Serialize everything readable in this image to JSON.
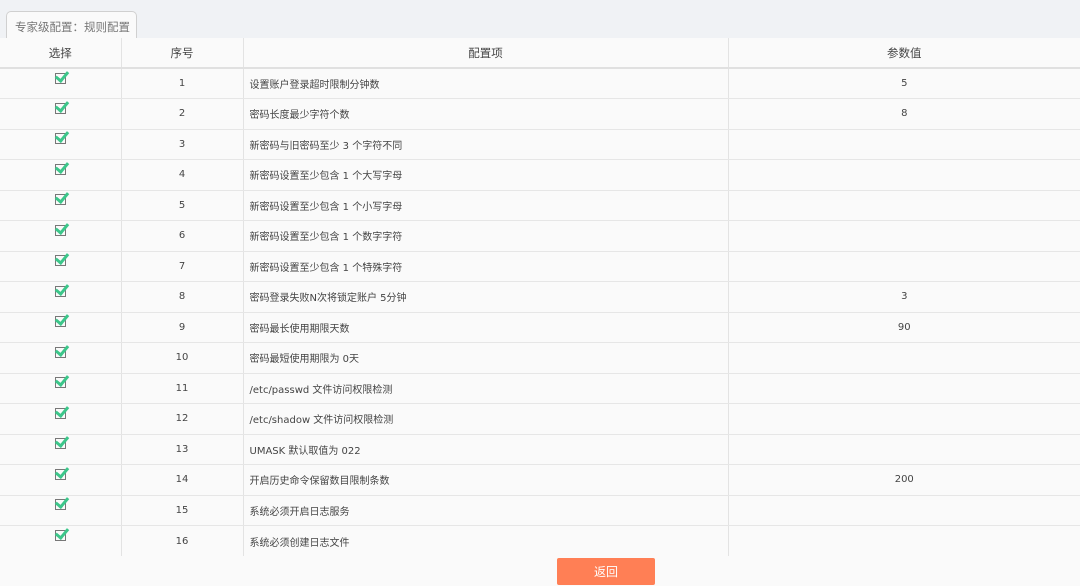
{
  "tab": "专家级配置：规则配置",
  "columns": [
    "选择",
    "序号",
    "配置项",
    "参数值"
  ],
  "rows": [
    {
      "no": "1",
      "item": "设置账户登录超时限制分钟数",
      "value": "5"
    },
    {
      "no": "2",
      "item": "密码长度最少字符个数",
      "value": "8"
    },
    {
      "no": "3",
      "item": "新密码与旧密码至少 3 个字符不同",
      "value": ""
    },
    {
      "no": "4",
      "item": "新密码设置至少包含 1 个大写字母",
      "value": ""
    },
    {
      "no": "5",
      "item": "新密码设置至少包含 1 个小写字母",
      "value": ""
    },
    {
      "no": "6",
      "item": "新密码设置至少包含 1 个数字字符",
      "value": ""
    },
    {
      "no": "7",
      "item": "新密码设置至少包含 1 个特殊字符",
      "value": ""
    },
    {
      "no": "8",
      "item": "密码登录失败N次将锁定账户 5分钟",
      "value": "3"
    },
    {
      "no": "9",
      "item": "密码最长使用期限天数",
      "value": "90"
    },
    {
      "no": "10",
      "item": "密码最短使用期限为 0天",
      "value": ""
    },
    {
      "no": "11",
      "item": "/etc/passwd 文件访问权限检测",
      "value": ""
    },
    {
      "no": "12",
      "item": "/etc/shadow 文件访问权限检测",
      "value": ""
    },
    {
      "no": "13",
      "item": "UMASK 默认取值为 022",
      "value": ""
    },
    {
      "no": "14",
      "item": "开启历史命令保留数目限制条数",
      "value": "200"
    },
    {
      "no": "15",
      "item": "系统必须开启日志服务",
      "value": ""
    },
    {
      "no": "16",
      "item": "系统必须创建日志文件",
      "value": ""
    }
  ],
  "back_button": "返回",
  "colors": {
    "check": "#3cc68a",
    "button": "#ff7f55"
  }
}
